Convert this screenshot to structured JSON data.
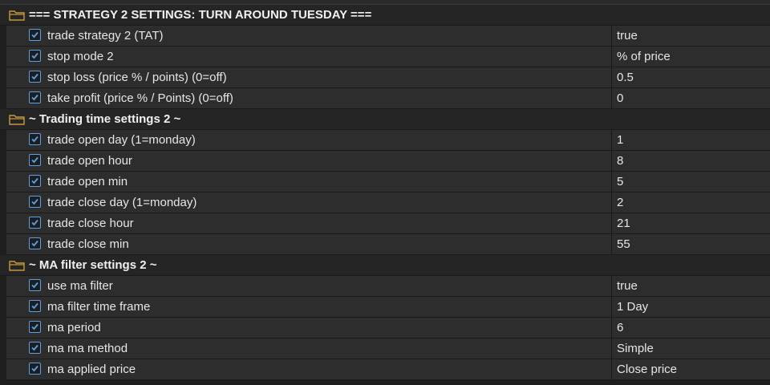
{
  "groups": [
    {
      "title": "=== STRATEGY 2 SETTINGS: TURN AROUND TUESDAY ===",
      "items": [
        {
          "name": "trade strategy 2 (TAT)",
          "value": "true"
        },
        {
          "name": "stop mode 2",
          "value": "% of price"
        },
        {
          "name": "stop loss (price % / points) (0=off)",
          "value": "0.5"
        },
        {
          "name": "take profit (price % / Points) (0=off)",
          "value": "0"
        }
      ]
    },
    {
      "title": "~ Trading time settings 2 ~",
      "items": [
        {
          "name": "trade open day (1=monday)",
          "value": "1"
        },
        {
          "name": "trade open hour",
          "value": "8"
        },
        {
          "name": "trade open min",
          "value": "5"
        },
        {
          "name": "trade close day (1=monday)",
          "value": "2"
        },
        {
          "name": "trade close hour",
          "value": "21"
        },
        {
          "name": "trade close min",
          "value": "55"
        }
      ]
    },
    {
      "title": "~ MA filter settings 2 ~",
      "items": [
        {
          "name": "use ma filter",
          "value": "true"
        },
        {
          "name": "ma filter time frame",
          "value": "1 Day"
        },
        {
          "name": "ma period",
          "value": "6"
        },
        {
          "name": "ma ma method",
          "value": "Simple"
        },
        {
          "name": "ma applied price",
          "value": "Close price"
        }
      ]
    }
  ],
  "colors": {
    "background": "#1e1e1e",
    "group_row": "#252526",
    "item_row": "#2d2d2d",
    "checkbox_accent": "#5aa0e6",
    "folder": "#c89a3c"
  },
  "icons": {
    "group": "folder-icon",
    "item": "checkbox-checked-icon"
  }
}
